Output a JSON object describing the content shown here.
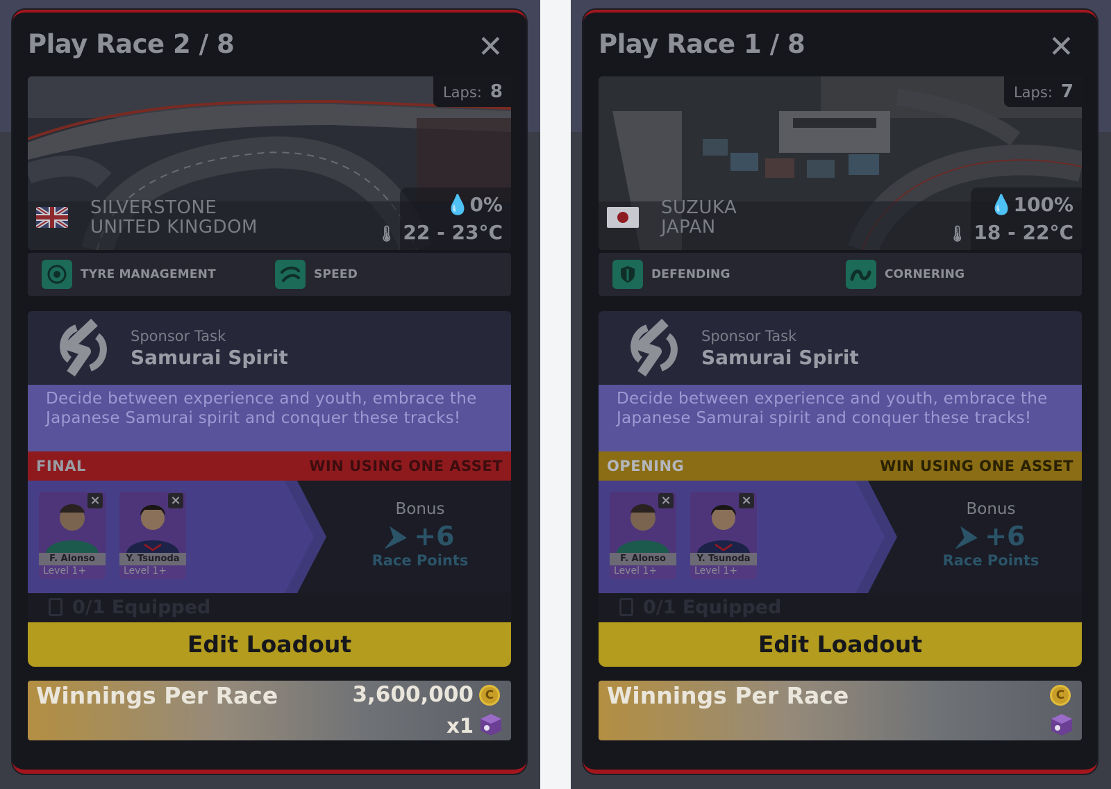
{
  "cards": [
    {
      "title": "Play Race 2 / 8",
      "close_glyph": "✕",
      "laps_label": "Laps:",
      "laps_value": "8",
      "flag": "uk-flag",
      "track_name": "SILVERSTONE",
      "country": "UNITED KINGDOM",
      "rain": "0%",
      "temp": "22 - 23°C",
      "traits": [
        {
          "icon": "tyre-icon",
          "label": "TYRE MANAGEMENT"
        },
        {
          "icon": "speed-icon",
          "label": "SPEED"
        }
      ],
      "sponsor_task_label": "Sponsor Task",
      "sponsor_name": "Samurai Spirit",
      "description": "Decide between experience and youth, embrace the Japanese Samurai spirit and conquer these tracks!",
      "stage_label": "FINAL",
      "stage_requirement": "WIN USING ONE ASSET",
      "stage_color": "#8f1a1e",
      "stage_left_color": "#9a9ca4",
      "stage_right_color": "#3d0d0f",
      "drivers": [
        {
          "name": "F. Alonso",
          "level": "Level 1+"
        },
        {
          "name": "Y. Tsunoda",
          "level": "Level 1+"
        }
      ],
      "bonus_label": "Bonus",
      "bonus_value": "+6",
      "bonus_points": "Race Points",
      "equipped": "0/1 Equipped",
      "loadout_label": "Edit Loadout",
      "winnings_label": "Winnings Per Race",
      "winnings_value": "3,600,000",
      "coin_glyph": "C",
      "multiplier": "x1"
    },
    {
      "title": "Play Race 1 / 8",
      "close_glyph": "✕",
      "laps_label": "Laps:",
      "laps_value": "7",
      "flag": "japan-flag",
      "track_name": "SUZUKA",
      "country": "JAPAN",
      "rain": "100%",
      "temp": "18 - 22°C",
      "traits": [
        {
          "icon": "shield-icon",
          "label": "DEFENDING"
        },
        {
          "icon": "cornering-icon",
          "label": "CORNERING"
        }
      ],
      "sponsor_task_label": "Sponsor Task",
      "sponsor_name": "Samurai Spirit",
      "description": "Decide between experience and youth, embrace the Japanese Samurai spirit and conquer these tracks!",
      "stage_label": "OPENING",
      "stage_requirement": "WIN USING ONE ASSET",
      "stage_color": "#8a6d14",
      "stage_left_color": "#b4b6bc",
      "stage_right_color": "#2a2104",
      "drivers": [
        {
          "name": "F. Alonso",
          "level": "Level 1+"
        },
        {
          "name": "Y. Tsunoda",
          "level": "Level 1+"
        }
      ],
      "bonus_label": "Bonus",
      "bonus_value": "+6",
      "bonus_points": "Race Points",
      "equipped": "0/1 Equipped",
      "loadout_label": "Edit Loadout",
      "winnings_label": "Winnings Per Race",
      "winnings_value": "",
      "coin_glyph": "C",
      "multiplier": ""
    }
  ]
}
